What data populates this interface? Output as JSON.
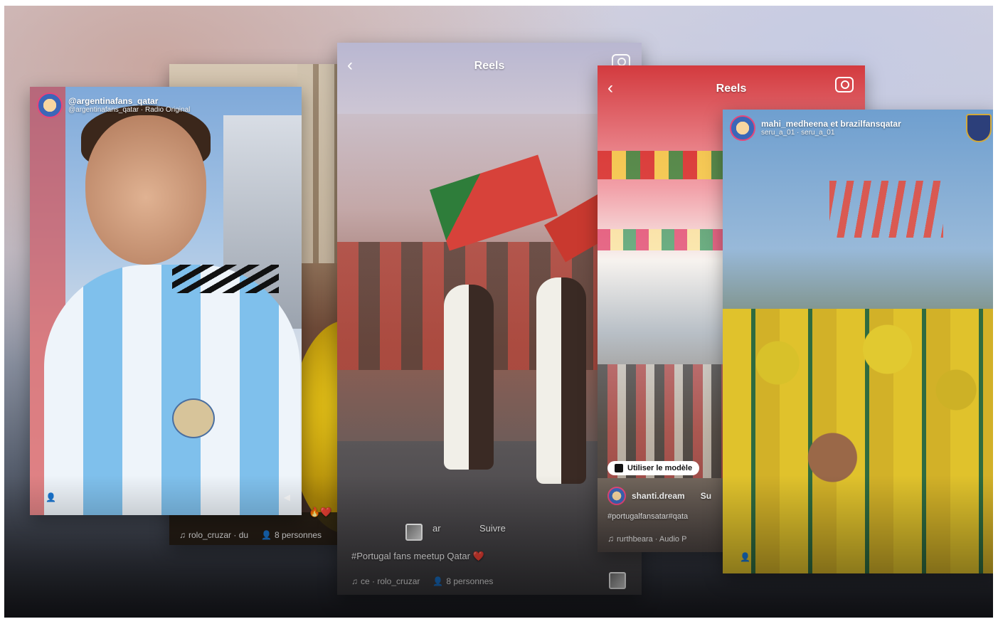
{
  "cards": {
    "boy": {
      "username": "@argentinafans_qatar",
      "subtitle": "@argentinafans_qatar · Radio Original"
    },
    "back": {
      "caption_emoji": "🔥❤️",
      "audio": "rolo_cruzar · du",
      "people": "8 personnes"
    },
    "center": {
      "title": "Reels",
      "caption": "#Portugal fans meetup Qatar ❤️",
      "audio": "ce · rolo_cruzar",
      "people": "8 personnes",
      "partial_text_left": "ar",
      "partial_text_right": "Suivre"
    },
    "right": {
      "title": "Reels",
      "pill": "Utiliser le modèle",
      "user": "shanti.dream",
      "user_partial": "Su",
      "hashtags": "#portugalfansatar#qata",
      "audio": "rurthbeara · Audio P"
    },
    "brazil": {
      "username": "mahi_medheena et brazilfansqatar",
      "subtitle": "seru_a_01 · seru_a_01"
    }
  },
  "icons": {
    "back": "chevron-left-icon",
    "camera": "camera-icon",
    "music": "music-note-icon",
    "people": "person-icon",
    "thumb": "audio-thumbnail-icon"
  }
}
